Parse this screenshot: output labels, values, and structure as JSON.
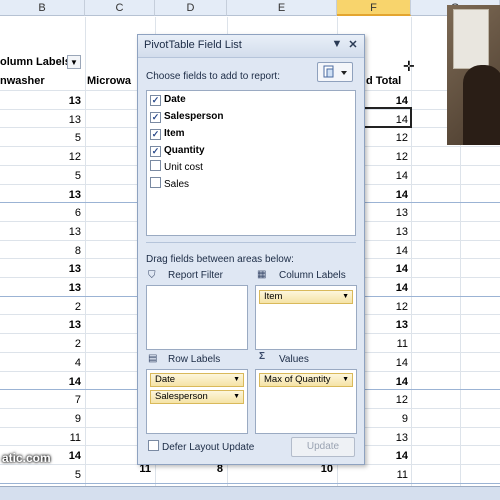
{
  "sheet": {
    "columns": [
      "B",
      "C",
      "D",
      "E",
      "F",
      "G"
    ],
    "selected_column": "F",
    "pivot_headers": {
      "column_labels": "olumn Labels",
      "dishwasher": "nwasher",
      "microwave": "Microwa",
      "grand_total": "d Total"
    },
    "col_b_values": [
      "13",
      "13",
      "5",
      "12",
      "5",
      "13",
      "6",
      "13",
      "8",
      "13",
      "13",
      "2",
      "13",
      "2",
      "4",
      "14",
      "7",
      "9",
      "11",
      "14",
      "5"
    ],
    "col_f_values": [
      "14",
      "14",
      "12",
      "12",
      "14",
      "14",
      "13",
      "13",
      "14",
      "14",
      "14",
      "12",
      "13",
      "11",
      "14",
      "14",
      "12",
      "9",
      "13",
      "14",
      "11"
    ],
    "bottom_row": {
      "c": "11",
      "d": "8",
      "e": "10"
    }
  },
  "panel": {
    "title": "PivotTable Field List",
    "choose_label": "Choose fields to add to report:",
    "fields": [
      {
        "name": "Date",
        "checked": true
      },
      {
        "name": "Salesperson",
        "checked": true
      },
      {
        "name": "Item",
        "checked": true
      },
      {
        "name": "Quantity",
        "checked": true
      },
      {
        "name": "Unit cost",
        "checked": false
      },
      {
        "name": "Sales",
        "checked": false
      }
    ],
    "drag_label": "Drag fields between areas below:",
    "report_filter": "Report Filter",
    "column_labels": "Column Labels",
    "row_labels": "Row Labels",
    "values": "Values",
    "column_items": [
      "Item"
    ],
    "row_items": [
      "Date",
      "Salesperson"
    ],
    "value_items": [
      "Max of Quantity"
    ],
    "defer_label": "Defer Layout Update",
    "update_label": "Update"
  },
  "watermark": "atic.com",
  "colors": {
    "accent_chip": "#f5e3a6",
    "panel_bg": "#dfe7f3",
    "selected_col": "#f8d46c"
  }
}
